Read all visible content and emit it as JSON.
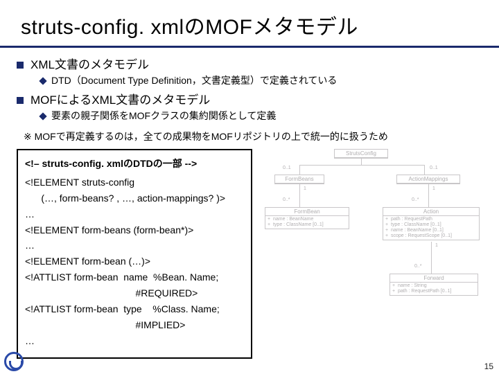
{
  "title": "struts-config. xmlのMOFメタモデル",
  "bullets": {
    "b1": "XML文書のメタモデル",
    "b1_1": "DTD（Document Type Definition，文書定義型）で定義されている",
    "b2": "MOFによるXML文書のメタモデル",
    "b2_1": "要素の親子関係をMOFクラスの集約関係として定義"
  },
  "note": "※ MOFで再定義するのは，全ての成果物をMOFリポジトリの上で統一的に扱うため",
  "code": {
    "header": "<!– struts-config. xmlのDTDの一部 -->",
    "l1": "<!ELEMENT struts-config",
    "l2": "      (…, form-beans? , …, action-mappings? )>",
    "l3": "…",
    "l4": "<!ELEMENT form-beans (form-bean*)>",
    "l5": "…",
    "l6": "<!ELEMENT form-bean (…)>",
    "l7": "<!ATTLIST form-bean  name  %Bean. Name;",
    "l8": "                                         #REQUIRED>",
    "l9": "<!ATTLIST form-bean  type    %Class. Name;",
    "l10": "                                         #IMPLIED>",
    "l11": "…"
  },
  "uml": {
    "box_struts": "StrutsConfig",
    "box_formbeans": "FormBeans",
    "box_actionmappings": "ActionMappings",
    "box_formbean": "FormBean",
    "box_formbean_attrs": "+  name : BeanName\n+  type : ClassName [0..1]",
    "box_action": "Action",
    "box_action_attrs": "+  path : RequestPath\n+  type : ClassName [0..1]\n+  name : BeanName [0..1]\n+  scope : RequestScope [0..1]",
    "box_forward": "Forward",
    "box_forward_attrs": "+  name : String\n+  path : RequestPath [0..1]",
    "m_01a": "0..1",
    "m_01b": "0..1",
    "m_0sa": "0..*",
    "m_0sb": "0..*",
    "m_0sc": "0..*",
    "m_1a": "1",
    "m_1b": "1",
    "m_1c": "1"
  },
  "page": "15"
}
